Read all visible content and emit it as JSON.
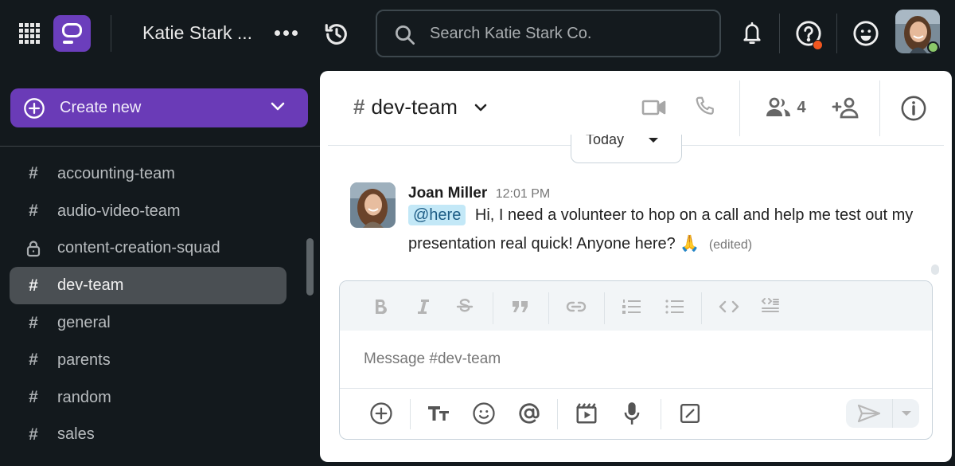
{
  "topbar": {
    "workspace_name": "Katie Stark ...",
    "search_placeholder": "Search Katie Stark Co.",
    "icons": [
      "apps-grid-icon",
      "app-logo",
      "more-icon",
      "history-icon",
      "search-icon",
      "bell-icon",
      "help-icon",
      "emoji-icon",
      "user-avatar"
    ],
    "colors": {
      "brand": "#6b3ebc",
      "help_badge": "#f1561f",
      "presence_online": "#8bc86a"
    }
  },
  "sidebar": {
    "create_label": "Create new",
    "channels": [
      {
        "name": "accounting-team",
        "icon": "hash",
        "active": false
      },
      {
        "name": "audio-video-team",
        "icon": "hash",
        "active": false
      },
      {
        "name": "content-creation-squad",
        "icon": "lock",
        "active": false
      },
      {
        "name": "dev-team",
        "icon": "hash",
        "active": true
      },
      {
        "name": "general",
        "icon": "hash",
        "active": false
      },
      {
        "name": "parents",
        "icon": "hash",
        "active": false
      },
      {
        "name": "random",
        "icon": "hash",
        "active": false
      },
      {
        "name": "sales",
        "icon": "hash",
        "active": false
      }
    ],
    "hash_glyph": "#"
  },
  "channel": {
    "hash": "#",
    "name": "dev-team",
    "member_count": "4",
    "date_divider": "Today"
  },
  "message": {
    "author": "Joan Miller",
    "time": "12:01 PM",
    "mention": "@here",
    "text": "Hi, I need a volunteer to hop on a call and help me test out my presentation real quick! Anyone here?",
    "emoji": "🙏",
    "edited": "(edited)"
  },
  "composer": {
    "placeholder": "Message #dev-team",
    "format_tools": [
      "bold",
      "italic",
      "strikethrough",
      "quote",
      "link",
      "numbered-list",
      "bulleted-list",
      "code",
      "code-block"
    ],
    "actions": [
      "attach",
      "text-format",
      "emoji",
      "mention",
      "video-clip",
      "voice-clip",
      "slash-command",
      "send",
      "send-options"
    ]
  }
}
